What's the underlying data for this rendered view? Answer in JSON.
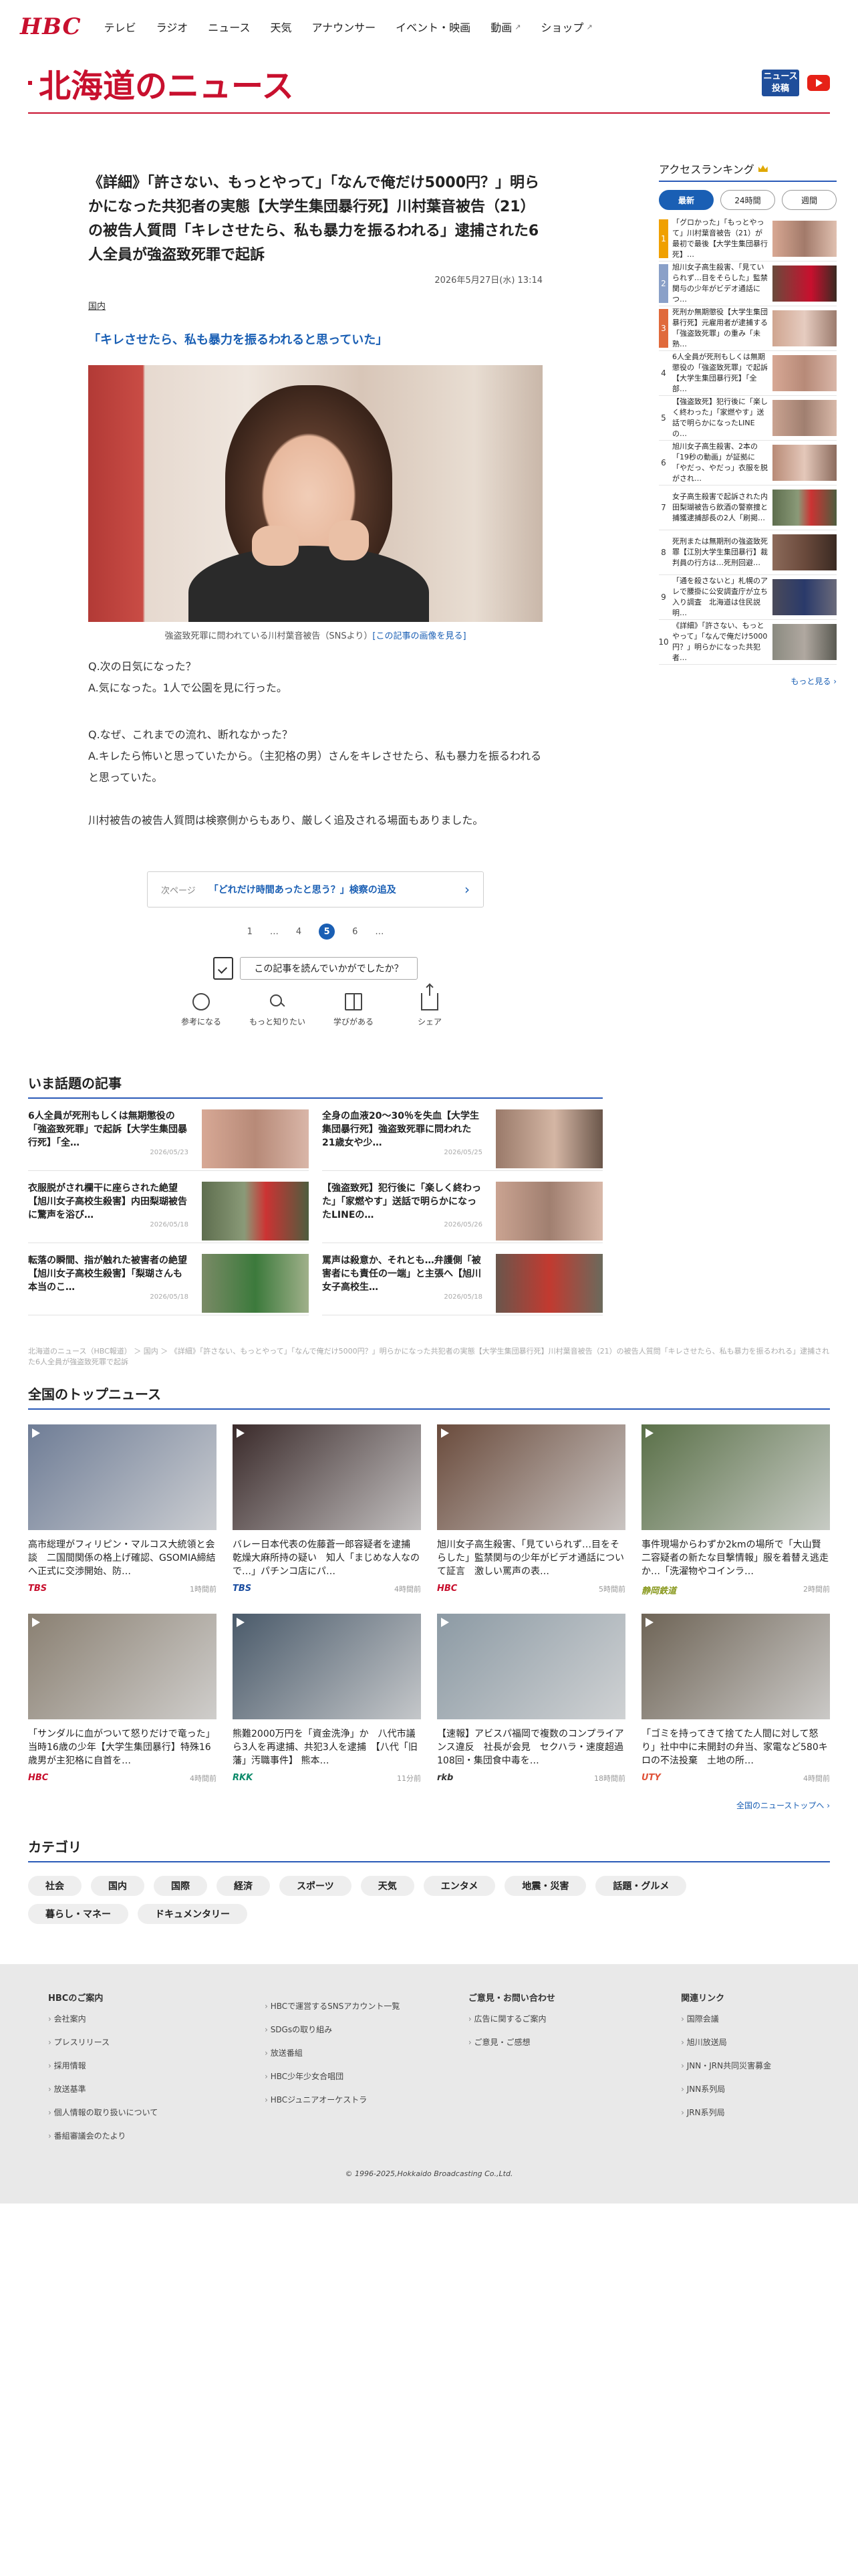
{
  "header": {
    "logo": "HBC",
    "nav": [
      {
        "label": "テレビ",
        "ext": false
      },
      {
        "label": "ラジオ",
        "ext": false
      },
      {
        "label": "ニュース",
        "ext": false
      },
      {
        "label": "天気",
        "ext": false
      },
      {
        "label": "アナウンサー",
        "ext": false
      },
      {
        "label": "イベント・映画",
        "ext": false
      },
      {
        "label": "動画",
        "ext": true
      },
      {
        "label": "ショップ",
        "ext": true
      }
    ],
    "site_title": "北海道のニュース",
    "news_badge": "ニュース投稿"
  },
  "article": {
    "title": "《詳細》「許さない、もっとやって」「なんで俺だけ5000円？」明らかになった共犯者の実態【大学生集団暴行死】川村葉音被告（21）の被告人質問「キレさせたら、私も暴力を振るわれる」逮捕された6人全員が強盗致死罪で起訴",
    "date": "2026年5月27日(水) 13:14",
    "category": "国内",
    "subheading": "「キレさせたら、私も暴力を振るわれると思っていた」",
    "caption": "強盗致死罪に問われている川村葉音被告（SNSより）",
    "caption_link": "[この記事の画像を見る]",
    "qa": [
      [
        "Q.次の日気になった？",
        "A.気になった。1人で公園を見に行った。"
      ],
      [
        "Q.なぜ、これまでの流れ、断れなかった？",
        "A.キレたら怖いと思っていたから。（主犯格の男）さんをキレさせたら、私も暴力を振るわれると思っていた。"
      ]
    ],
    "closing": "川村被告の被告人質問は検察側からもあり、厳しく追及される場面もありました。",
    "next_label": "次ページ",
    "next_title": "「どれだけ時間あったと思う？」検察の追及",
    "pager": [
      "1",
      "…",
      "4",
      "5",
      "6",
      "…"
    ],
    "pager_current": "5",
    "feedback": "この記事を読んでいかがでしたか？",
    "reactions": [
      "参考になる",
      "もっと知りたい",
      "学びがある",
      "シェア"
    ]
  },
  "trending": {
    "title": "いま話題の記事",
    "items": [
      {
        "text": "6人全員が死刑もしくは無期懲役の「強盗致死罪」で起訴【大学生集団暴行死】「全…",
        "date": "2026/05/23"
      },
      {
        "text": "全身の血液20～30％を失血【大学生集団暴行死】強盗致死罪に問われた21歳女や少…",
        "date": "2026/05/25"
      },
      {
        "text": "衣服脱がされ欄干に座らされた絶望【旭川女子高校生殺害】内田梨瑚被告に驚声を浴び…",
        "date": "2026/05/18"
      },
      {
        "text": "【強盗致死】犯行後に「楽しく終わった」「家燃やす」送話で明らかになったLINEの…",
        "date": "2026/05/26"
      },
      {
        "text": "転落の瞬間、指が触れた被害者の絶望【旭川女子高校生殺害】「梨瑚さんも本当のこ…",
        "date": "2026/05/18"
      },
      {
        "text": "罵声は殺意か、それとも…弁護側「被害者にも責任の一端」と主張へ【旭川女子高校生…",
        "date": "2026/05/18"
      }
    ]
  },
  "ranking": {
    "title": "アクセスランキング",
    "tabs": [
      "最新",
      "24時間",
      "週間"
    ],
    "items": [
      "「グロかった」「もっとやって」川村葉音被告（21）が最初で最後【大学生集団暴行死】…",
      "旭川女子高生殺害、「見ていられず…目をそらした」監禁関与の少年がビデオ通話につ…",
      "死刑か無期懲役【大学生集団暴行死】元雇用者が逮捕する「強盗致死罪」の重み「未熟…",
      "6人全員が死刑もしくは無期懲役の「強盗致死罪」で起訴【大学生集団暴行死】「全部…",
      "【強盗致死】犯行後に「楽しく終わった」「家燃やす」送話で明らかになったLINEの…",
      "旭川女子高生殺害、2本の「19秒の動画」が証拠に「やだっ、やだっ」衣服を脱がされ…",
      "女子高生殺害で起訴された内田梨瑚被告ら飲酒の警察捜と捕獲逮捕部長の2人「刷掲…",
      "死刑または無期刑の強盗致死罪【江別大学生集団暴行】裁判員の行方は…死刑回避…",
      "「通を殺さないと」札幌のアレで腰掛に公安調査庁が立ち入り調査　北海道は住民説明…",
      "《詳細》「許さない、もっとやって」「なんで俺だけ5000円？」明らかになった共犯者…"
    ],
    "more": "もっと見る"
  },
  "breadcrumb": "北海道のニュース（HBC報道） ＞ 国内 ＞ 《詳細》「許さない、もっとやって」「なんで俺だけ5000円？」明らかになった共犯者の実態【大学生集団暴行死】川村葉音被告（21）の被告人質問「キレさせたら、私も暴力を振るわれる」逮捕された6人全員が強盗致死罪で起訴",
  "national": {
    "title": "全国のトップニュース",
    "items": [
      {
        "title": "高市総理がフィリピン・マルコス大統領と会談　二国間関係の格上げ確認、GSOMIA締結へ正式に交渉開始、防…",
        "src": "TBS",
        "ago": "1時間前",
        "color": "#c8102e",
        "img": "#6f7d96"
      },
      {
        "title": "バレー日本代表の佐藤蒼一郎容疑者を逮捕　乾燥大麻所持の疑い　知人「まじめな人なので…」パチンコ店にパ…",
        "src": "TBS",
        "ago": "4時間前",
        "color": "#1a4da0",
        "img": "#3a2a2a"
      },
      {
        "title": "旭川女子高生殺害、「見ていられず…目をそらした」監禁関与の少年がビデオ通話について証言　激しい罵声の表…",
        "src": "HBC",
        "ago": "5時間前",
        "color": "#c8102e",
        "img": "#6a4b3c"
      },
      {
        "title": "事件現場からわずか2kmの場所で「大山賢二容疑者の新たな目撃情報」服を着替え逃走か…「洗濯物やコインラ…",
        "src": "静岡鉄道",
        "ago": "2時間前",
        "color": "#8a9a20",
        "img": "#5a7048"
      },
      {
        "title": "「サンダルに血がついて怒りだけで竜った」当時16歳の少年【大学生集団暴行】特殊16歳男が主犯格に自首を…",
        "src": "HBC",
        "ago": "4時間前",
        "color": "#c8102e",
        "img": "#8a8072"
      },
      {
        "title": "熊難2000万円を「資金洗浄」か　八代市議ら3人を再逮捕、共犯3人を逮捕　【八代「旧藩」汚職事件】 熊本…",
        "src": "RKK",
        "ago": "11分前",
        "color": "#0d8a6a",
        "img": "#4a5a6a"
      },
      {
        "title": "【速報】アビスパ福岡で複数のコンプライアンス違反　社長が会見　セクハラ・速度超過108回・集団食中毒を…",
        "src": "rkb",
        "ago": "18時間前",
        "color": "#333333",
        "img": "#8c9aa4"
      },
      {
        "title": "「ゴミを持ってきて捨てた人間に対して怒り」社中中に未開封の弁当、家電など580キロの不法投棄　土地の所…",
        "src": "UTY",
        "ago": "4時間前",
        "color": "#e0533a",
        "img": "#6e6456"
      }
    ],
    "more": "全国のニューストップへ"
  },
  "categories": {
    "title": "カテゴリ",
    "items": [
      "社会",
      "国内",
      "国際",
      "経済",
      "スポーツ",
      "天気",
      "エンタメ",
      "地震・災害",
      "話題・グルメ",
      "暮らし・マネー",
      "ドキュメンタリー"
    ]
  },
  "footer": {
    "cols": [
      {
        "title": "HBCのご案内",
        "items": [
          "会社案内",
          "プレスリリース",
          "採用情報",
          "放送基準",
          "個人情報の取り扱いについて",
          "番組審議会のたより"
        ]
      },
      {
        "title": "",
        "items": [
          "HBCで運営するSNSアカウント一覧",
          "SDGsの取り組み",
          "放送番組",
          "HBC少年少女合唱団",
          "HBCジュニアオーケストラ"
        ]
      },
      {
        "title": "ご意見・お問い合わせ",
        "items": [
          "広告に関するご案内",
          "ご意見・ご感想"
        ]
      },
      {
        "title": "関連リンク",
        "items": [
          "国際会議",
          "旭川放送局",
          "JNN・JRN共同災害募金",
          "JNN系列局",
          "JRN系列局"
        ]
      }
    ],
    "copyright": "© 1996-2025,Hokkaido Broadcasting Co.,Ltd."
  }
}
